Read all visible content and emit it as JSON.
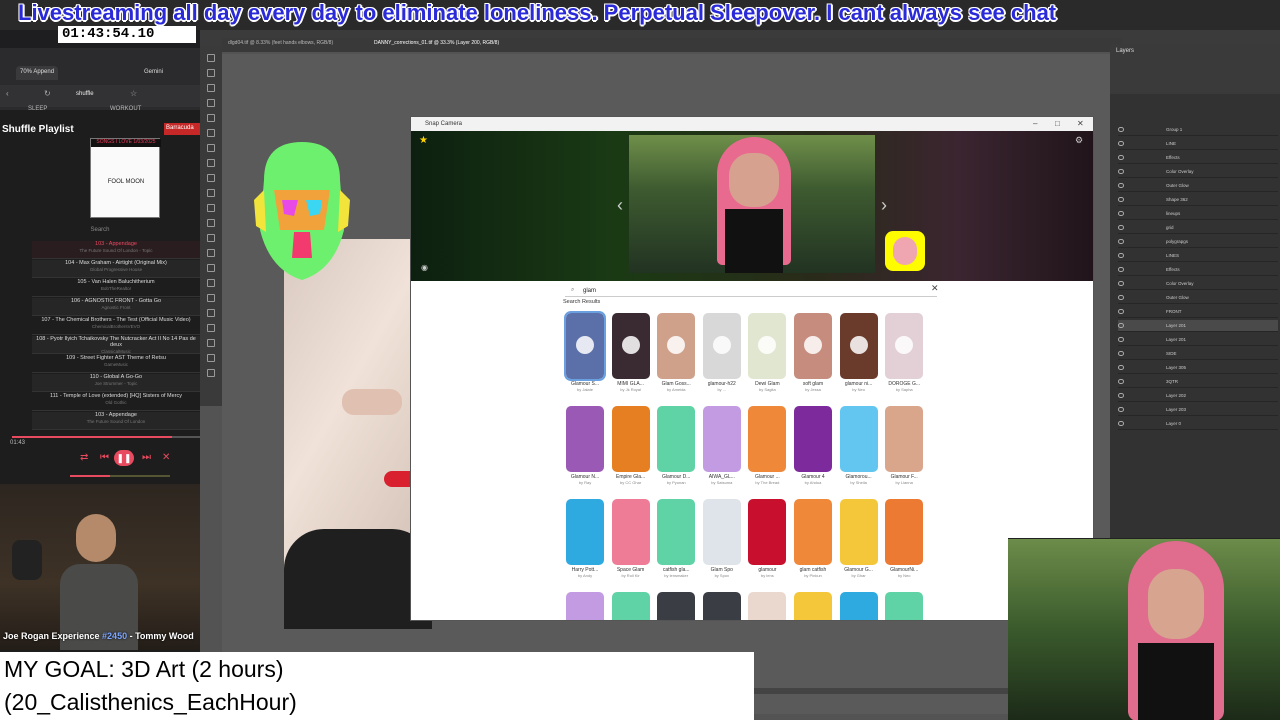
{
  "banner": {
    "text": "Livestreaming all day every day to eliminate loneliness. Perpetual Sleepover. I cant always see chat"
  },
  "timer": {
    "text": "01:43:54.10"
  },
  "browser": {
    "tabs": [
      "70% Append",
      "Gemini"
    ],
    "bookmarks": [
      "SLEEP",
      "WORKOUT"
    ],
    "address": "shuffle"
  },
  "playlist": {
    "title": "Shuffle Playlist",
    "live_badge": "Barracuda",
    "album_top": "SONGS I LOVE  1/03/2025",
    "album_center": "FOOL MOON",
    "search_label": "Search",
    "songs": [
      {
        "title": "103 - Appendage",
        "artist": "The Future Sound Of London - Topic",
        "active": true
      },
      {
        "title": "104 - Max Graham - Airtight (Original Mix)",
        "artist": "Global Progressive House",
        "active": false
      },
      {
        "title": "105 - Van Halen Baluchitherium",
        "artist": "BobTheRealtor",
        "active": false
      },
      {
        "title": "106 - AGNOSTIC FRONT - Gotta Go",
        "artist": "Agnostic Front",
        "active": false
      },
      {
        "title": "107 - The Chemical Brothers - The Test (Official Music Video)",
        "artist": "ChemicalBrothersVEVO",
        "active": false
      },
      {
        "title": "108 - Pyotr Ilyich Tchaikovsky The Nutcracker Act II No 14 Pas de deux",
        "artist": "ClassicalMusic",
        "active": false
      },
      {
        "title": "109 - Street Fighter AST Theme of Retsu",
        "artist": "GameMusic",
        "active": false
      },
      {
        "title": "110 - Global A Go-Go",
        "artist": "Joe Strummer - Topic",
        "active": false
      },
      {
        "title": "111 - Temple of Love (extended) [HQ] Sisters of Mercy",
        "artist": "Old Gothic",
        "active": false
      },
      {
        "title": "103 - Appendage",
        "artist": "The Future Sound Of London",
        "active": false
      }
    ],
    "time": "01:43",
    "progress": 0.85
  },
  "jre": {
    "prefix": "Joe Rogan Experience ",
    "number": "#2450",
    "suffix": " - Tommy Wood"
  },
  "goal": {
    "line1": "MY GOAL: 3D Art (2 hours)",
    "line2": "(20_Calisthenics_EachHour)"
  },
  "photoshop": {
    "doc_tabs": [
      "dlgd04.tif @ 8.33% (feet hands elbows, RGB/8)",
      "DANNY_corrections_01.tif @ 33.3% (Layer 200, RGB/8)"
    ],
    "panel_title": "Layers",
    "layers": [
      "Group 1",
      "LINE",
      "Effects",
      "Color Overlay",
      "Outer Glow",
      "Shape 362",
      "lineups",
      "grid",
      "polygrapgs",
      "LINES",
      "Effects",
      "Color Overlay",
      "Outer Glow",
      "FRONT",
      "Layer 201",
      "Layer 201",
      "SIDE",
      "Layer 305",
      "3QTR",
      "Layer 202",
      "Layer 203",
      "Layer 0"
    ]
  },
  "snap": {
    "title": "Snap Camera",
    "search_value": "glam",
    "results_label": "Search Results",
    "lenses": [
      {
        "name": "Glamour S...",
        "by": "by Jalate",
        "color": "#5b6fa8"
      },
      {
        "name": "MIMI GLA...",
        "by": "by Jk Royal",
        "color": "#3a2a32"
      },
      {
        "name": "Glam Goss...",
        "by": "by Ameida",
        "color": "#cfa08a"
      },
      {
        "name": "glamour-h22",
        "by": "by ...",
        "color": "#d8d8d8"
      },
      {
        "name": "Dewi Glam",
        "by": "by Sagita",
        "color": "#e0e6cf"
      },
      {
        "name": "soft glam",
        "by": "by Jessa",
        "color": "#c68d7e"
      },
      {
        "name": "glamour ni...",
        "by": "by Neo",
        "color": "#6a3a2a"
      },
      {
        "name": "DOROGE G...",
        "by": "by Sapha",
        "color": "#e2d0d6"
      },
      {
        "name": "Glamour N...",
        "by": "by Ray",
        "color": "#9b59b6"
      },
      {
        "name": "Empire Gla...",
        "by": "by CC Ghar",
        "color": "#e67e22"
      },
      {
        "name": "Glamour D...",
        "by": "by Pyonan",
        "color": "#5fd3a5"
      },
      {
        "name": "AIWA_GL...",
        "by": "by Satsuma",
        "color": "#c39be3"
      },
      {
        "name": "Glamour ...",
        "by": "by The Bread",
        "color": "#f0883a"
      },
      {
        "name": "Glamour 4",
        "by": "by Ahdua",
        "color": "#7d2a9c"
      },
      {
        "name": "Glamorou...",
        "by": "by Sheila",
        "color": "#63c6f0"
      },
      {
        "name": "Glamour F...",
        "by": "by Lianna",
        "color": "#d9a68c"
      },
      {
        "name": "Harry Pott...",
        "by": "by Andy",
        "color": "#2eaae1"
      },
      {
        "name": "Space Glam",
        "by": "by Roll Kir",
        "color": "#ee7c96"
      },
      {
        "name": "catfish gla...",
        "by": "by lensmaker",
        "color": "#5fd3a5"
      },
      {
        "name": "Glam Spo",
        "by": "by Spox",
        "color": "#dfe4ea"
      },
      {
        "name": "glamour",
        "by": "by lens",
        "color": "#c8102e"
      },
      {
        "name": "glam catfish",
        "by": "by Pinkun",
        "color": "#f0883a"
      },
      {
        "name": "Glamour G...",
        "by": "by Ghar",
        "color": "#f4c73a"
      },
      {
        "name": "GlamourNi...",
        "by": "by Neo",
        "color": "#ec7a32"
      },
      {
        "name": "",
        "by": "",
        "color": "#c39be3"
      },
      {
        "name": "",
        "by": "",
        "color": "#5fd3a5"
      },
      {
        "name": "",
        "by": "",
        "color": "#3a3d44"
      },
      {
        "name": "",
        "by": "",
        "color": "#3a3d44"
      },
      {
        "name": "",
        "by": "",
        "color": "#ead8cf"
      },
      {
        "name": "",
        "by": "",
        "color": "#f4c73a"
      },
      {
        "name": "",
        "by": "",
        "color": "#2eaae1"
      },
      {
        "name": "",
        "by": "",
        "color": "#5fd3a5"
      }
    ]
  }
}
